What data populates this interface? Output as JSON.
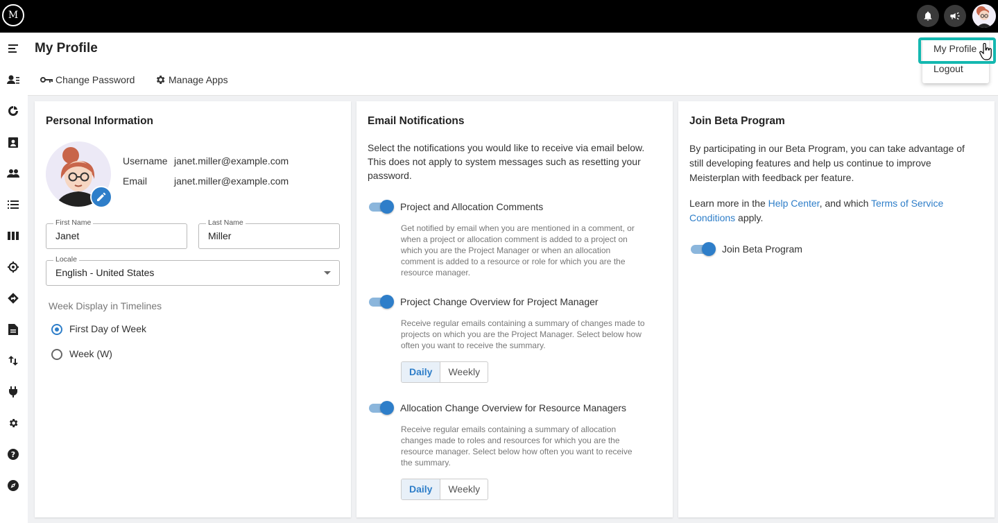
{
  "topbar": {
    "logo_text": "M",
    "icons": [
      "bell-icon",
      "megaphone-icon"
    ]
  },
  "header": {
    "title": "My Profile",
    "change_password": "Change Password",
    "manage_apps": "Manage Apps"
  },
  "dropdown": {
    "my_profile": "My Profile",
    "logout": "Logout"
  },
  "sidebar": {
    "icons": [
      "menu-icon",
      "resources-icon",
      "portfolio-icon",
      "assignment-icon",
      "people-icon",
      "list-icon",
      "board-icon",
      "target-icon",
      "roadmap-icon",
      "report-icon",
      "import-export-icon",
      "plugin-icon",
      "settings-icon",
      "help-icon",
      "explore-icon"
    ]
  },
  "personal": {
    "title": "Personal Information",
    "username_label": "Username",
    "username": "janet.miller@example.com",
    "email_label": "Email",
    "email": "janet.miller@example.com",
    "first_name_label": "First Name",
    "first_name": "Janet",
    "last_name_label": "Last Name",
    "last_name": "Miller",
    "locale_label": "Locale",
    "locale": "English - United States",
    "week_display_label": "Week Display in Timelines",
    "option_first_day": "First Day of Week",
    "option_week": "Week (W)"
  },
  "email": {
    "title": "Email Notifications",
    "intro_1": "Select the notifications you would like to receive via email below.",
    "intro_2": "This does not apply to system messages such as resetting your",
    "intro_3": "password.",
    "n1_label": "Project and Allocation Comments",
    "n1_desc_1": "Get notified by email when you are mentioned in a comment, or",
    "n1_desc_2": "when a project or allocation comment is added to a project on",
    "n1_desc_3": "which you are the Project Manager or when an allocation",
    "n1_desc_4": "comment is added to a resource or role for which you are the",
    "n1_desc_5": "resource manager.",
    "n2_label": "Project Change Overview for Project Manager",
    "n2_desc_1": "Receive regular emails containing a summary of changes made to",
    "n2_desc_2": "projects on which you are the Project Manager. Select below how",
    "n2_desc_3": "often you want to receive the summary.",
    "n3_label": "Allocation Change Overview for Resource Managers",
    "n3_desc_1": "Receive regular emails containing a summary of allocation",
    "n3_desc_2": "changes made to roles and resources for which you are the",
    "n3_desc_3": "resource manager. Select below how often you want to receive",
    "n3_desc_4": "the summary.",
    "daily": "Daily",
    "weekly": "Weekly"
  },
  "beta": {
    "title": "Join Beta Program",
    "p1_1": "By participating in our Beta Program, you can take advantage of",
    "p1_2": "still developing features and help us continue to improve",
    "p1_3": "Meisterplan with feedback per feature.",
    "p2_a": "Learn more in the ",
    "help_center": "Help Center",
    "p2_b": ", and which ",
    "terms_1": "Terms of Service",
    "terms_2": "Conditions",
    "p2_c": " apply.",
    "toggle_label": "Join Beta Program"
  },
  "colors": {
    "accent": "#2e7ec9",
    "highlight": "#14b8b0"
  }
}
